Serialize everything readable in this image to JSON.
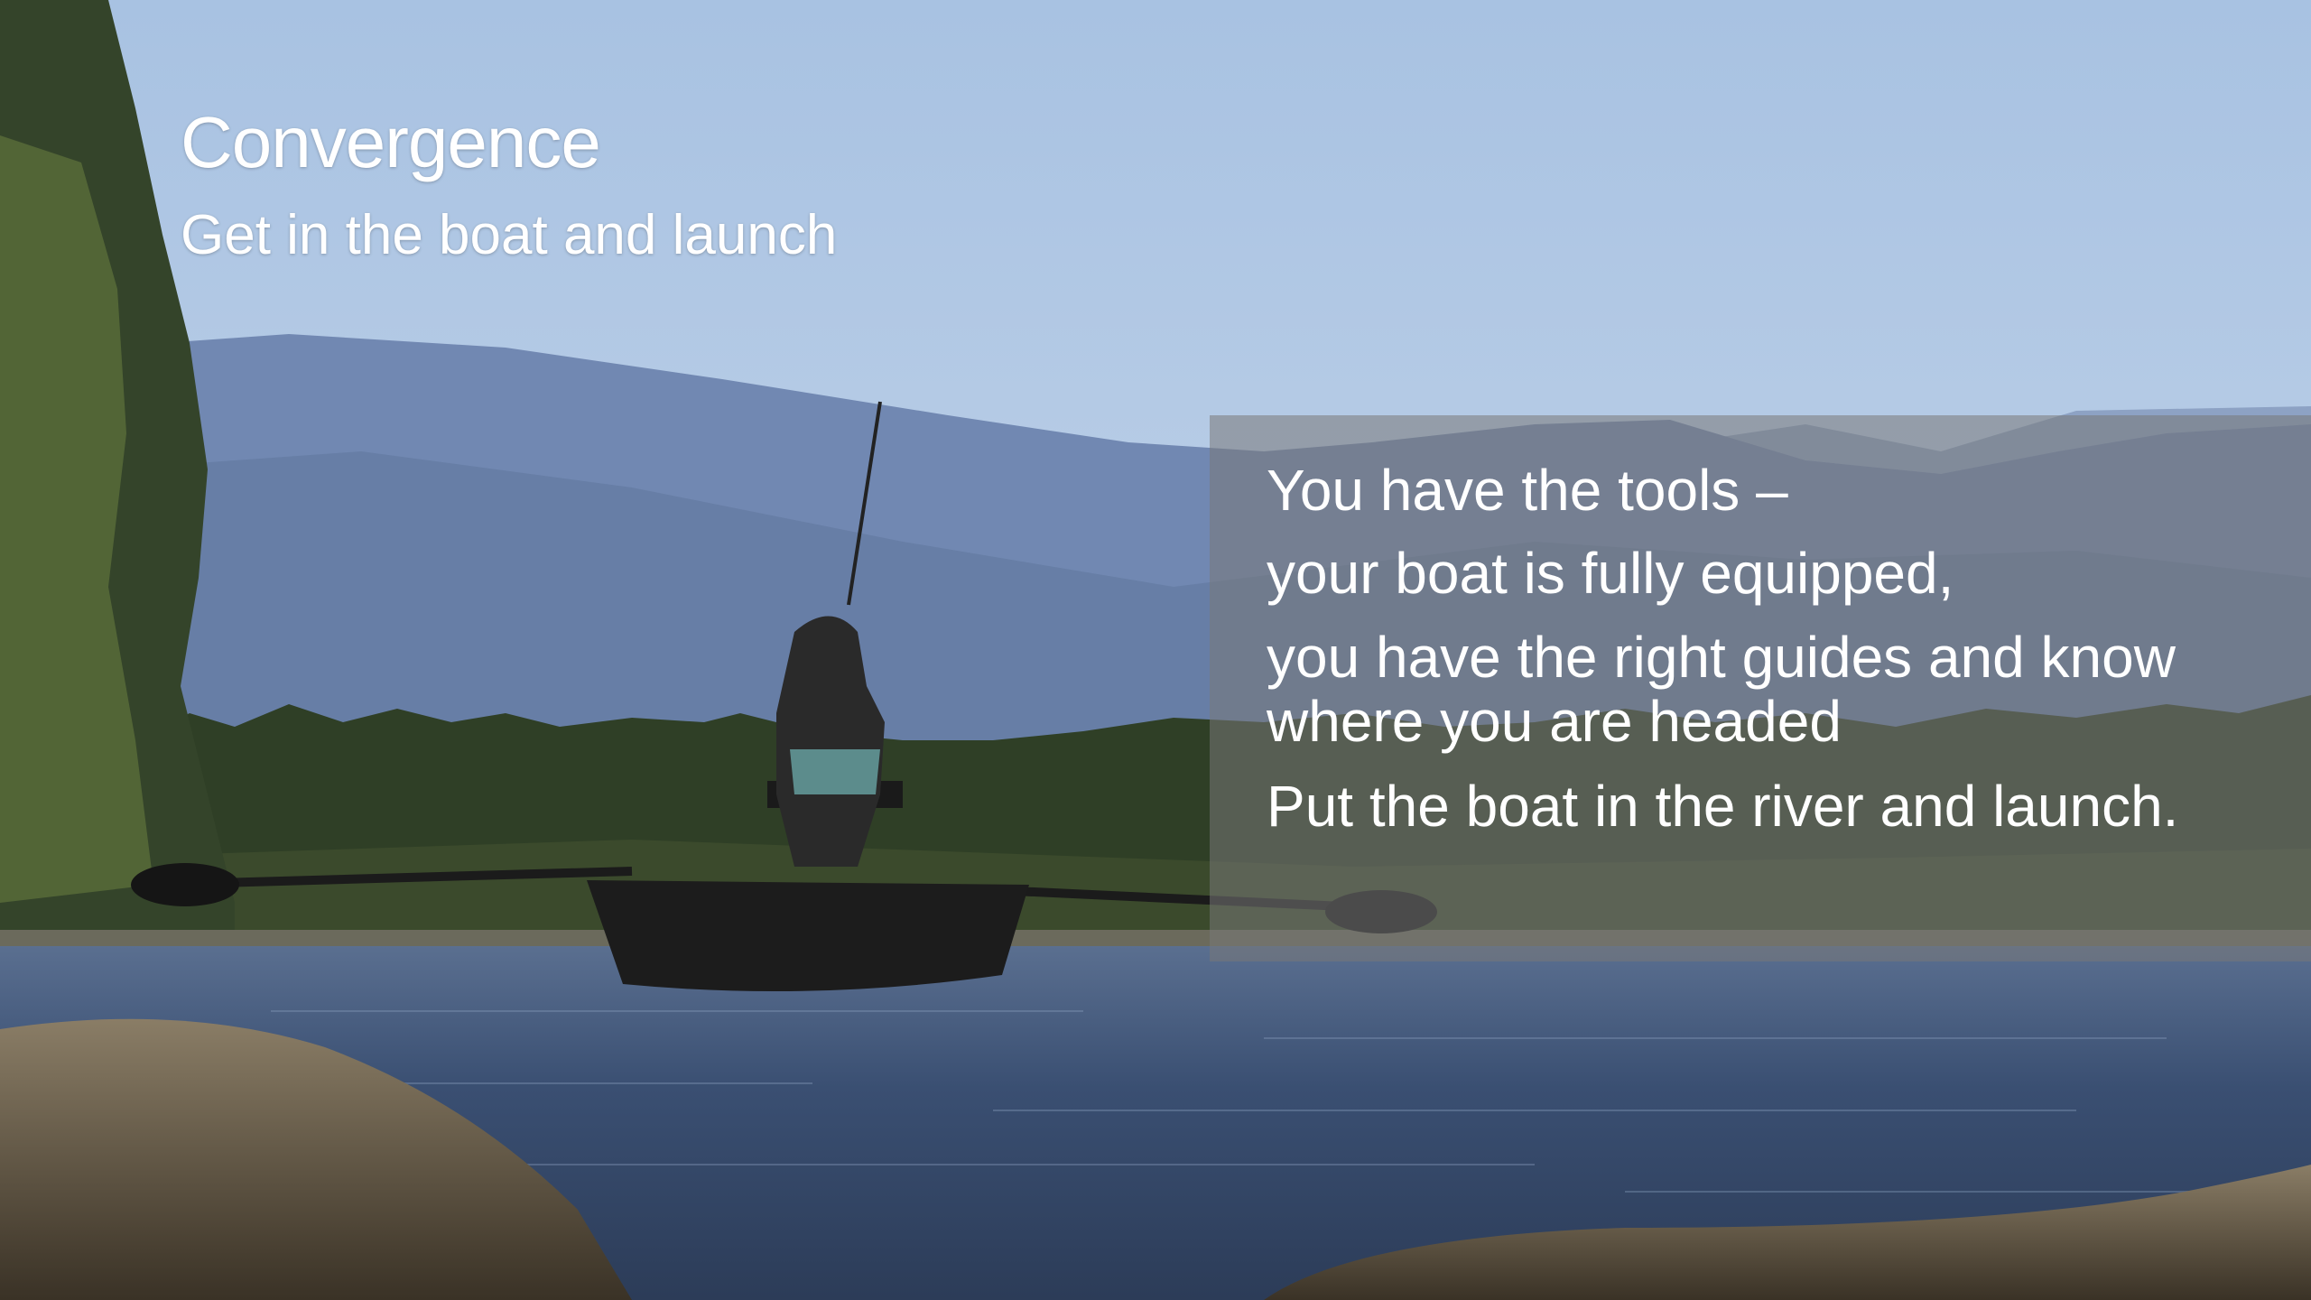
{
  "slide": {
    "title": "Convergence",
    "subtitle": "Get in the boat and launch"
  },
  "quote": {
    "lines": [
      "You have the tools –",
      "your boat is fully equipped,",
      "you have the right guides and know where you are headed",
      "Put the boat in the river and launch."
    ]
  },
  "colors": {
    "sky": "#b4cbe6",
    "mountain": "#6f86b0",
    "forest": "#2e3c22",
    "water": "#3f5577",
    "panel": "#787878",
    "text": "#ffffff"
  }
}
